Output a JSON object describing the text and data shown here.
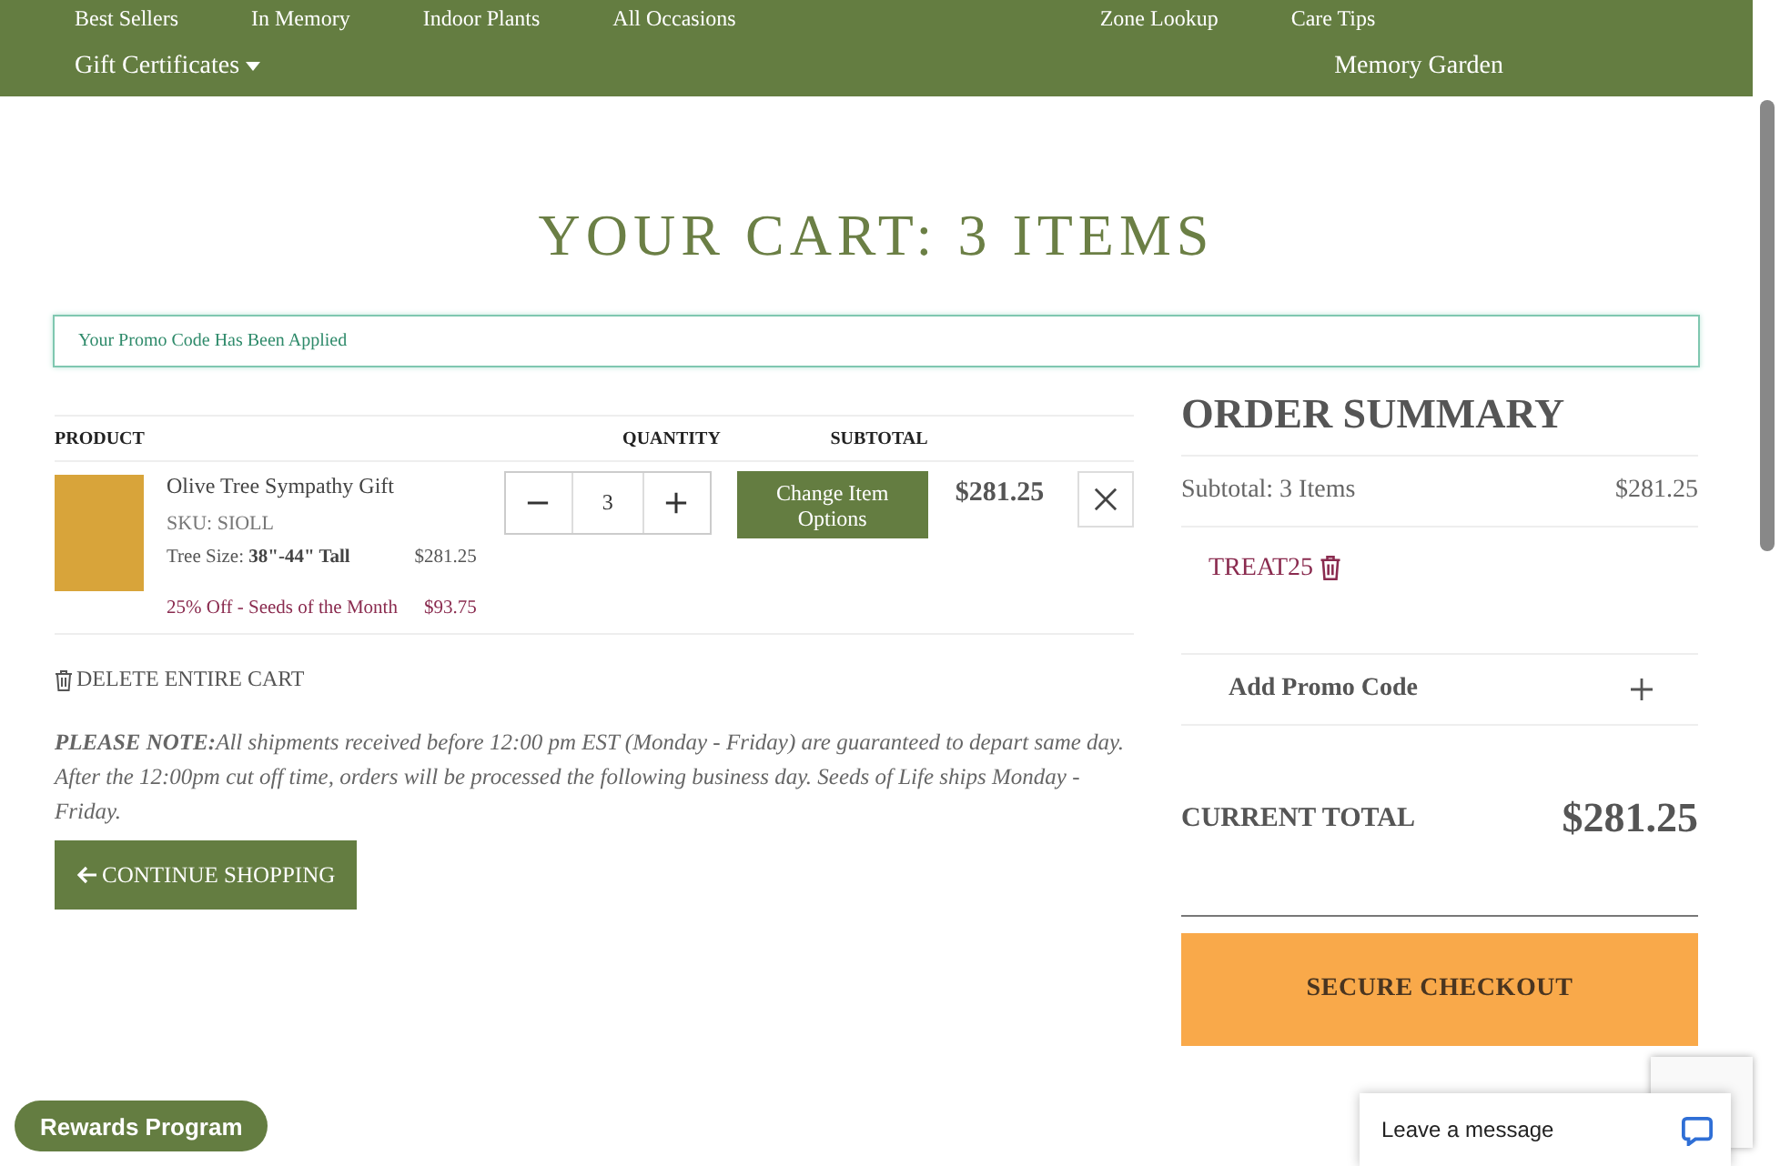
{
  "nav": {
    "rows": [
      [
        {
          "label": "Best Sellers",
          "has_menu": false
        },
        {
          "label": "In Memory",
          "has_menu": false
        },
        {
          "label": "Indoor Plants",
          "has_menu": false
        },
        {
          "label": "All Occasions",
          "has_menu": false
        },
        {
          "label": "Zone Lookup",
          "has_menu": false
        },
        {
          "label": "Care Tips",
          "has_menu": false
        }
      ],
      [
        {
          "label": "Gift Certificates",
          "has_menu": true
        },
        {
          "label": "Memory Garden",
          "has_menu": false
        }
      ]
    ]
  },
  "title": "YOUR CART: 3 ITEMS",
  "promo_message": "Your Promo Code Has Been Applied",
  "cart": {
    "columns": [
      "PRODUCT",
      "QUANTITY",
      "SUBTOTAL"
    ],
    "items": [
      {
        "name": "Olive Tree Sympathy Gift",
        "sku": "SKU: SIOLL",
        "option_label": "Tree Size:",
        "option_value": "38\"-44\" Tall",
        "price": "$281.25",
        "discount_label": "25% Off - Seeds of the Month",
        "discount_amount": "$93.75",
        "quantity": "3",
        "change_button": "Change Item Options",
        "subtotal": "$281.25"
      }
    ],
    "delete_cart": "DELETE ENTIRE CART",
    "note": "**PLEASE NOTE:**All shipments received before 12:00 pm EST (Monday - Friday) are guaranteed to depart same day. After the 12:00pm cut off time, orders will be processed the following business day. Seeds of Life ships Monday - Friday.",
    "continue_button": "CONTINUE SHOPPING"
  },
  "summary": {
    "title": "ORDER SUMMARY",
    "subtotal_label": "Subtotal: 3 Items",
    "subtotal_value": "$281.25",
    "promo_code": "TREAT25",
    "add_promo": "Add Promo Code",
    "add_promo_expanded": false,
    "total_label": "CURRENT TOTAL",
    "total_value": "$281.25",
    "checkout_button": "SECURE CHECKOUT"
  },
  "rewards_button": "Rewards Program",
  "chat": {
    "label": "Leave a message"
  }
}
